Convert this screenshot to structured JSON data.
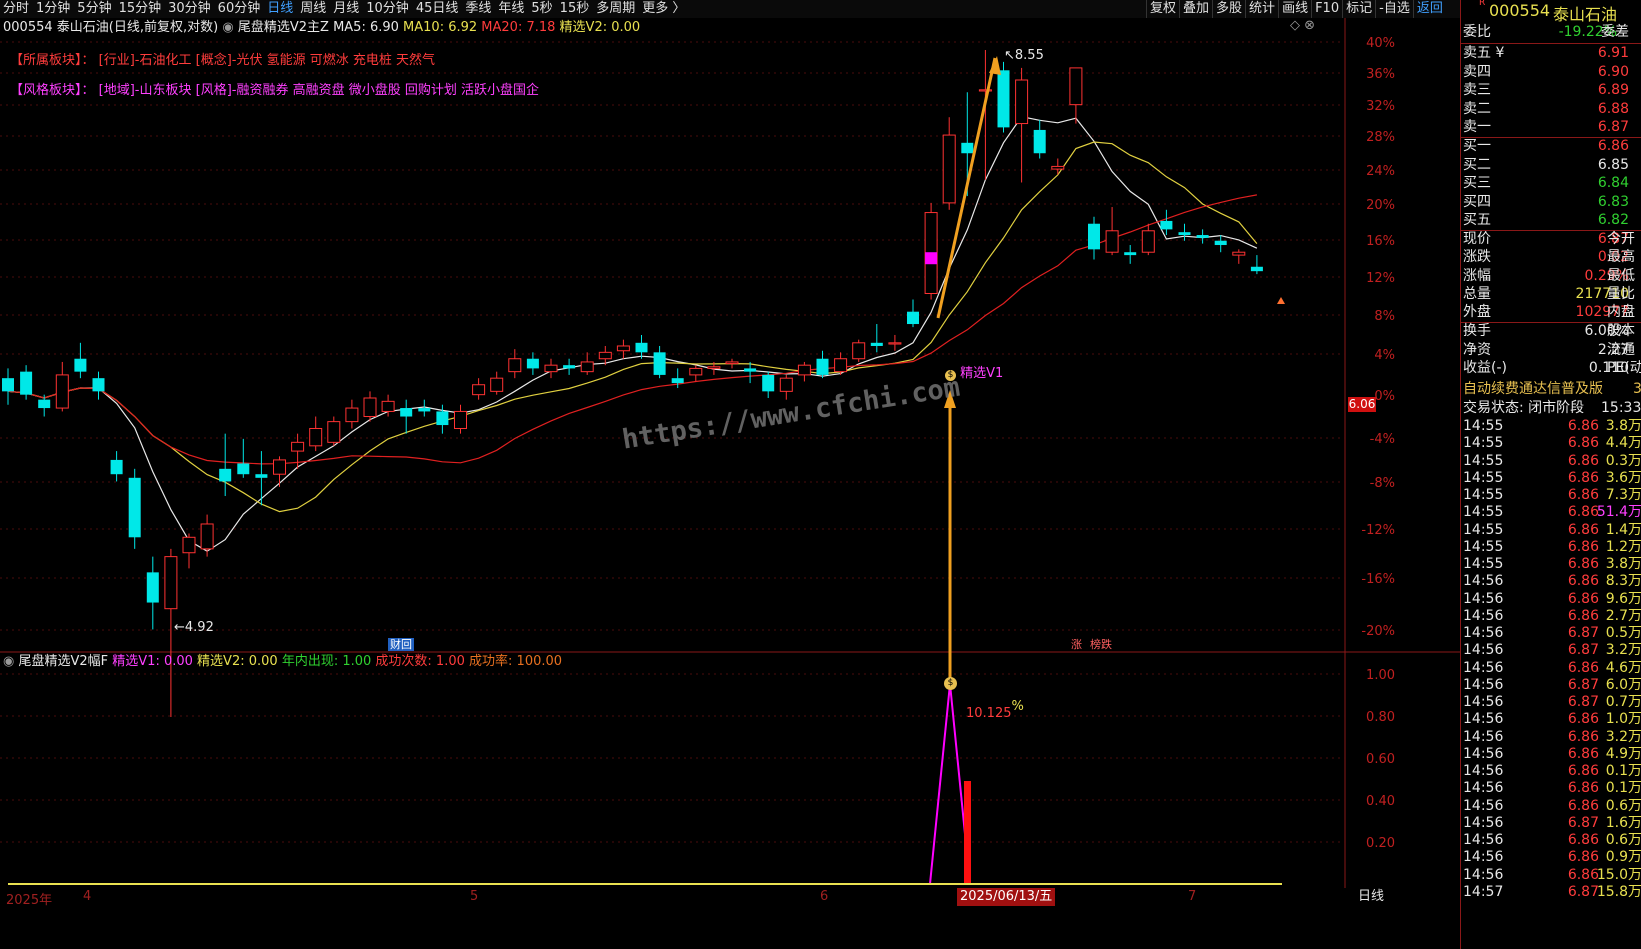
{
  "top_periods": [
    "分时",
    "1分钟",
    "5分钟",
    "15分钟",
    "30分钟",
    "60分钟",
    "日线",
    "周线",
    "月线",
    "10分钟",
    "45日线",
    "季线",
    "年线",
    "5秒",
    "15秒",
    "多周期",
    "更多 〉"
  ],
  "active_period": "日线",
  "toolbar": [
    "复权",
    "叠加",
    "多股",
    "统计",
    "画线",
    "F10",
    "标记",
    "-自选"
  ],
  "toolbar_back": "返回",
  "main_header": {
    "stock": "000554",
    "name": "泰山石油",
    "mode": "(日线,前复权,对数)",
    "indicator": "尾盘精选V2主Z",
    "ma5": "MA5: 6.90",
    "ma10": "MA10: 6.92",
    "ma20": "MA20: 7.18",
    "v2": "精选V2: 0.00"
  },
  "sector_line": {
    "label": "【所属板块】：",
    "text": "[行业]-石油化工 [概念]-光伏 氢能源 可燃冰 充电桩 天然气"
  },
  "style_line": {
    "label": "【风格板块】：",
    "text": "[地域]-山东板块 [风格]-融资融券 高融资盘 微小盘股 回购计划 活跃小盘国企"
  },
  "annotations": {
    "high": "8.55",
    "low": "4.92",
    "signal": "精选V1",
    "caihui": "财回",
    "zhang": "涨",
    "bangdie": "榜跌",
    "watermark": "https://www.cfchi.com",
    "pct": "10.125",
    "pct_sign": "%",
    "price_marker": "6.06",
    "zero_pct": "0%"
  },
  "pct_axis": [
    "40%",
    "36%",
    "32%",
    "28%",
    "24%",
    "20%",
    "16%",
    "12%",
    "8%",
    "4%",
    "-4%",
    "-8%",
    "-12%",
    "-16%",
    "-20%"
  ],
  "sub_axis": [
    "1.00",
    "0.80",
    "0.60",
    "0.40",
    "0.20"
  ],
  "sub_header": {
    "name": "尾盘精选V2幅F",
    "v1": "精选V1: 0.00",
    "v2": "精选V2: 0.00",
    "year": "年内出现: 1.00",
    "succ": "成功次数: 1.00",
    "rate": "成功率: 100.00"
  },
  "date_axis": {
    "year": "2025年",
    "m4": "4",
    "m5": "5",
    "m6": "6",
    "m7": "7",
    "current": "2025/06/13/五",
    "day_btn": "日线"
  },
  "quote": {
    "code": "000554",
    "name": "泰山石油",
    "r_mark": "R",
    "weibi_label": "委比",
    "weibi": "-19.22%",
    "weicha_label": "委差",
    "sell": [
      {
        "label": "卖五 ¥",
        "price": "6.91"
      },
      {
        "label": "卖四",
        "price": "6.90"
      },
      {
        "label": "卖三",
        "price": "6.89"
      },
      {
        "label": "卖二",
        "price": "6.88"
      },
      {
        "label": "卖一",
        "price": "6.87"
      }
    ],
    "buy": [
      {
        "label": "买一",
        "price": "6.86",
        "color": "#ff3c3c"
      },
      {
        "label": "买二",
        "price": "6.85",
        "color": "#e8e8e8"
      },
      {
        "label": "买三",
        "price": "6.84",
        "color": "#30d030"
      },
      {
        "label": "买四",
        "price": "6.83",
        "color": "#30d030"
      },
      {
        "label": "买五",
        "price": "6.82",
        "color": "#30d030"
      }
    ],
    "stats": [
      {
        "l": "现价",
        "v": "6.87",
        "c": "#ff3c3c",
        "r": "今开"
      },
      {
        "l": "涨跌",
        "v": "0.02",
        "c": "#ff3c3c",
        "r": "最高"
      },
      {
        "l": "涨幅",
        "v": "0.29%",
        "c": "#ff3c3c",
        "r": "最低"
      },
      {
        "l": "总量",
        "v": "217710",
        "c": "#e8e050",
        "r": "量比"
      },
      {
        "l": "外盘",
        "v": "102977",
        "c": "#ff3c3c",
        "r": "内盘"
      }
    ],
    "stats2": [
      {
        "l": "换手",
        "v": "6.00%",
        "c": "#e8e8e8",
        "r": "股本"
      },
      {
        "l": "净资",
        "v": "2.27",
        "c": "#e8e8e8",
        "r": "流通"
      },
      {
        "l": "收益(-)",
        "v": "0.110",
        "c": "#e8e8e8",
        "r": "PE(动)"
      }
    ],
    "banner": "自动续费通达信普及版",
    "banner_tail": "3",
    "trade_state": "交易状态: 闭市阶段",
    "trade_time": "15:33"
  },
  "ticks": [
    {
      "t": "14:55",
      "p": "6.86",
      "q": "3.8万",
      "qc": "#e8e050"
    },
    {
      "t": "14:55",
      "p": "6.86",
      "q": "4.4万",
      "qc": "#e8e050"
    },
    {
      "t": "14:55",
      "p": "6.86",
      "q": "0.3万",
      "qc": "#e8e050"
    },
    {
      "t": "14:55",
      "p": "6.86",
      "q": "3.6万",
      "qc": "#e8e050"
    },
    {
      "t": "14:55",
      "p": "6.86",
      "q": "7.3万",
      "qc": "#e8e050"
    },
    {
      "t": "14:55",
      "p": "6.86",
      "q": "51.4万",
      "qc": "#ff40ff"
    },
    {
      "t": "14:55",
      "p": "6.86",
      "q": "1.4万",
      "qc": "#e8e050"
    },
    {
      "t": "14:55",
      "p": "6.86",
      "q": "1.2万",
      "qc": "#e8e050"
    },
    {
      "t": "14:55",
      "p": "6.86",
      "q": "3.8万",
      "qc": "#e8e050"
    },
    {
      "t": "14:56",
      "p": "6.86",
      "q": "8.3万",
      "qc": "#e8e050"
    },
    {
      "t": "14:56",
      "p": "6.86",
      "q": "9.6万",
      "qc": "#e8e050"
    },
    {
      "t": "14:56",
      "p": "6.86",
      "q": "2.7万",
      "qc": "#e8e050"
    },
    {
      "t": "14:56",
      "p": "6.87",
      "q": "0.5万",
      "qc": "#e8e050"
    },
    {
      "t": "14:56",
      "p": "6.87",
      "q": "3.2万",
      "qc": "#e8e050"
    },
    {
      "t": "14:56",
      "p": "6.86",
      "q": "4.6万",
      "qc": "#e8e050"
    },
    {
      "t": "14:56",
      "p": "6.87",
      "q": "6.0万",
      "qc": "#e8e050"
    },
    {
      "t": "14:56",
      "p": "6.87",
      "q": "0.7万",
      "qc": "#e8e050"
    },
    {
      "t": "14:56",
      "p": "6.86",
      "q": "1.0万",
      "qc": "#e8e050"
    },
    {
      "t": "14:56",
      "p": "6.86",
      "q": "3.2万",
      "qc": "#e8e050"
    },
    {
      "t": "14:56",
      "p": "6.86",
      "q": "4.9万",
      "qc": "#e8e050"
    },
    {
      "t": "14:56",
      "p": "6.86",
      "q": "0.1万",
      "qc": "#e8e050"
    },
    {
      "t": "14:56",
      "p": "6.86",
      "q": "0.1万",
      "qc": "#e8e050"
    },
    {
      "t": "14:56",
      "p": "6.86",
      "q": "0.6万",
      "qc": "#e8e050"
    },
    {
      "t": "14:56",
      "p": "6.87",
      "q": "1.6万",
      "qc": "#e8e050"
    },
    {
      "t": "14:56",
      "p": "6.86",
      "q": "0.6万",
      "qc": "#e8e050"
    },
    {
      "t": "14:56",
      "p": "6.86",
      "q": "0.9万",
      "qc": "#e8e050"
    },
    {
      "t": "14:56",
      "p": "6.86",
      "q": "15.0万",
      "qc": "#e8e050"
    },
    {
      "t": "14:57",
      "p": "6.87",
      "q": "15.8万",
      "qc": "#e8e050"
    }
  ],
  "candles": [
    {
      "o": 6.18,
      "h": 6.24,
      "l": 6.02,
      "c": 6.1
    },
    {
      "o": 6.22,
      "h": 6.26,
      "l": 6.05,
      "c": 6.08
    },
    {
      "o": 6.05,
      "h": 6.08,
      "l": 5.95,
      "c": 6.0
    },
    {
      "o": 6.0,
      "h": 6.28,
      "l": 5.98,
      "c": 6.2
    },
    {
      "o": 6.3,
      "h": 6.4,
      "l": 6.18,
      "c": 6.22
    },
    {
      "o": 6.18,
      "h": 6.22,
      "l": 6.05,
      "c": 6.1
    },
    {
      "o": 5.7,
      "h": 5.75,
      "l": 5.58,
      "c": 5.62
    },
    {
      "o": 5.6,
      "h": 5.65,
      "l": 5.22,
      "c": 5.28
    },
    {
      "o": 5.1,
      "h": 5.18,
      "l": 4.82,
      "c": 4.95
    },
    {
      "o": 4.92,
      "h": 5.22,
      "l": 4.42,
      "c": 5.18
    },
    {
      "o": 5.2,
      "h": 5.3,
      "l": 5.12,
      "c": 5.28
    },
    {
      "o": 5.22,
      "h": 5.4,
      "l": 5.18,
      "c": 5.35
    },
    {
      "o": 5.65,
      "h": 5.85,
      "l": 5.5,
      "c": 5.58
    },
    {
      "o": 5.68,
      "h": 5.82,
      "l": 5.6,
      "c": 5.62
    },
    {
      "o": 5.62,
      "h": 5.75,
      "l": 5.45,
      "c": 5.6
    },
    {
      "o": 5.62,
      "h": 5.72,
      "l": 5.55,
      "c": 5.7
    },
    {
      "o": 5.75,
      "h": 5.85,
      "l": 5.65,
      "c": 5.8
    },
    {
      "o": 5.78,
      "h": 5.95,
      "l": 5.75,
      "c": 5.88
    },
    {
      "o": 5.8,
      "h": 5.95,
      "l": 5.78,
      "c": 5.92
    },
    {
      "o": 5.92,
      "h": 6.05,
      "l": 5.88,
      "c": 6.0
    },
    {
      "o": 5.95,
      "h": 6.1,
      "l": 5.92,
      "c": 6.06
    },
    {
      "o": 5.98,
      "h": 6.08,
      "l": 5.95,
      "c": 6.04
    },
    {
      "o": 6.0,
      "h": 6.05,
      "l": 5.85,
      "c": 5.95
    },
    {
      "o": 6.0,
      "h": 6.05,
      "l": 5.95,
      "c": 5.98
    },
    {
      "o": 5.98,
      "h": 6.02,
      "l": 5.85,
      "c": 5.9
    },
    {
      "o": 5.88,
      "h": 6.02,
      "l": 5.85,
      "c": 5.98
    },
    {
      "o": 6.08,
      "h": 6.18,
      "l": 6.05,
      "c": 6.14
    },
    {
      "o": 6.1,
      "h": 6.22,
      "l": 6.08,
      "c": 6.18
    },
    {
      "o": 6.22,
      "h": 6.36,
      "l": 6.18,
      "c": 6.3
    },
    {
      "o": 6.3,
      "h": 6.34,
      "l": 6.2,
      "c": 6.24
    },
    {
      "o": 6.22,
      "h": 6.3,
      "l": 6.18,
      "c": 6.26
    },
    {
      "o": 6.26,
      "h": 6.3,
      "l": 6.2,
      "c": 6.24
    },
    {
      "o": 6.22,
      "h": 6.34,
      "l": 6.2,
      "c": 6.28
    },
    {
      "o": 6.3,
      "h": 6.38,
      "l": 6.26,
      "c": 6.34
    },
    {
      "o": 6.35,
      "h": 6.42,
      "l": 6.3,
      "c": 6.38
    },
    {
      "o": 6.4,
      "h": 6.45,
      "l": 6.3,
      "c": 6.34
    },
    {
      "o": 6.34,
      "h": 6.38,
      "l": 6.18,
      "c": 6.2
    },
    {
      "o": 6.18,
      "h": 6.24,
      "l": 6.12,
      "c": 6.15
    },
    {
      "o": 6.2,
      "h": 6.26,
      "l": 6.16,
      "c": 6.24
    },
    {
      "o": 6.24,
      "h": 6.28,
      "l": 6.2,
      "c": 6.25
    },
    {
      "o": 6.27,
      "h": 6.3,
      "l": 6.24,
      "c": 6.28
    },
    {
      "o": 6.24,
      "h": 6.28,
      "l": 6.15,
      "c": 6.22
    },
    {
      "o": 6.2,
      "h": 6.22,
      "l": 6.06,
      "c": 6.1
    },
    {
      "o": 6.1,
      "h": 6.2,
      "l": 6.05,
      "c": 6.18
    },
    {
      "o": 6.2,
      "h": 6.28,
      "l": 6.16,
      "c": 6.26
    },
    {
      "o": 6.3,
      "h": 6.35,
      "l": 6.18,
      "c": 6.2
    },
    {
      "o": 6.22,
      "h": 6.34,
      "l": 6.2,
      "c": 6.3
    },
    {
      "o": 6.3,
      "h": 6.42,
      "l": 6.28,
      "c": 6.4
    },
    {
      "o": 6.4,
      "h": 6.52,
      "l": 6.34,
      "c": 6.38
    },
    {
      "o": 6.4,
      "h": 6.45,
      "l": 6.35,
      "c": 6.4
    },
    {
      "o": 6.6,
      "h": 6.68,
      "l": 6.5,
      "c": 6.52
    },
    {
      "o": 6.72,
      "h": 7.35,
      "l": 6.68,
      "c": 7.28
    },
    {
      "o": 7.35,
      "h": 8.0,
      "l": 7.3,
      "c": 7.86
    },
    {
      "o": 7.8,
      "h": 8.2,
      "l": 7.4,
      "c": 7.72
    },
    {
      "o": 8.22,
      "h": 8.55,
      "l": 7.52,
      "c": 8.22
    },
    {
      "o": 8.38,
      "h": 8.45,
      "l": 7.88,
      "c": 7.92
    },
    {
      "o": 7.95,
      "h": 8.4,
      "l": 7.5,
      "c": 8.3
    },
    {
      "o": 7.9,
      "h": 7.98,
      "l": 7.68,
      "c": 7.72
    },
    {
      "o": 7.6,
      "h": 7.68,
      "l": 7.56,
      "c": 7.62
    },
    {
      "o": 8.1,
      "h": 8.28,
      "l": 7.95,
      "c": 8.4
    },
    {
      "o": 7.2,
      "h": 7.25,
      "l": 6.95,
      "c": 7.02
    },
    {
      "o": 7.0,
      "h": 7.32,
      "l": 6.98,
      "c": 7.15
    },
    {
      "o": 7.0,
      "h": 7.05,
      "l": 6.92,
      "c": 6.98
    },
    {
      "o": 7.0,
      "h": 7.2,
      "l": 6.98,
      "c": 7.15
    },
    {
      "o": 7.22,
      "h": 7.3,
      "l": 7.12,
      "c": 7.16
    },
    {
      "o": 7.14,
      "h": 7.2,
      "l": 7.08,
      "c": 7.12
    },
    {
      "o": 7.12,
      "h": 7.16,
      "l": 7.06,
      "c": 7.1
    },
    {
      "o": 7.08,
      "h": 7.12,
      "l": 7.0,
      "c": 7.05
    },
    {
      "o": 6.98,
      "h": 7.02,
      "l": 6.92,
      "c": 7.0
    },
    {
      "o": 6.9,
      "h": 6.98,
      "l": 6.85,
      "c": 6.87
    }
  ]
}
